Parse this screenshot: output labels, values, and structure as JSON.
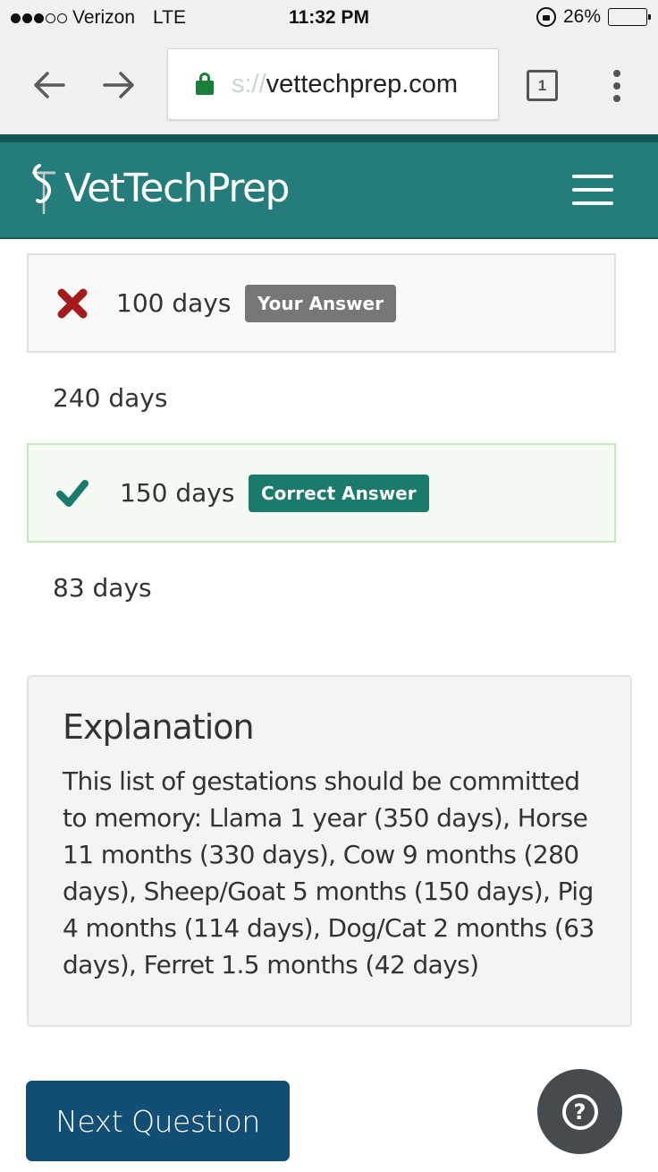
{
  "status_bar": {
    "signal_filled": 3,
    "signal_total": 5,
    "carrier": "Verizon",
    "network": "LTE",
    "time": "11:32 PM",
    "battery_percent_label": "26%",
    "battery_level": 0.26
  },
  "browser": {
    "url_scheme_fragment": "s://",
    "url_host": "vettechprep.com",
    "tab_count": "1",
    "icons": {
      "back": "arrow-left-icon",
      "forward": "arrow-right-icon",
      "secure": "lock-icon",
      "menu": "more-vert-icon"
    }
  },
  "header": {
    "logo_text": "VetTechPrep",
    "menu_icon": "hamburger-icon",
    "colors": {
      "primary": "#247d7a",
      "top_band": "#125857"
    }
  },
  "answers": [
    {
      "text": "100 days",
      "state": "wrong",
      "badge": "Your Answer",
      "icon": "x-mark-icon",
      "color": "#a31b1b"
    },
    {
      "text": "240 days",
      "state": "neutral"
    },
    {
      "text": "150 days",
      "state": "correct",
      "badge": "Correct Answer",
      "icon": "checkmark-icon",
      "color": "#1a7a6b"
    },
    {
      "text": "83 days",
      "state": "neutral"
    }
  ],
  "explanation": {
    "title": "Explanation",
    "body": "This list of gestations should be committed to memory: Llama 1 year (350 days), Horse 11 months (330 days), Cow 9 months (280 days), Sheep/Goat 5 months (150 days), Pig 4 months (114 days), Dog/Cat 2 months (63 days), Ferret 1.5 months (42 days)"
  },
  "actions": {
    "next_label": "Next Question",
    "next_color": "#134e74",
    "help_icon": "question-circle-icon",
    "help_glyph": "?"
  }
}
